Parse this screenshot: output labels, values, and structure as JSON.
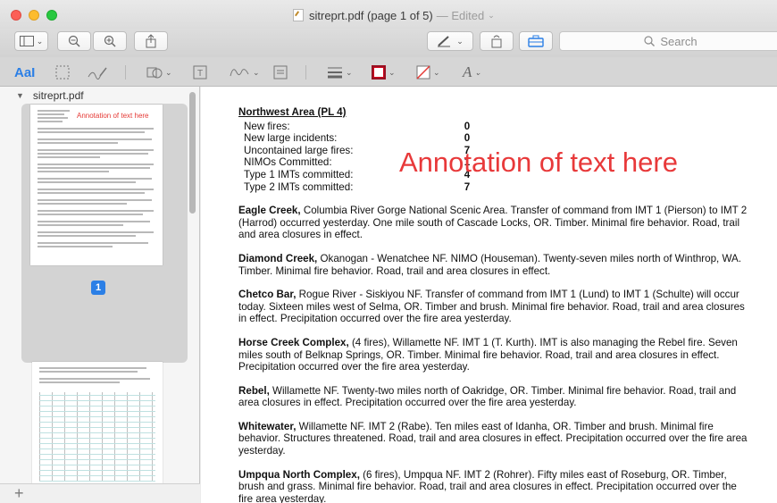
{
  "window": {
    "title": "sitreprt.pdf (page 1 of 5)",
    "edited": "— Edited"
  },
  "toolbar": {
    "search_placeholder": "Search"
  },
  "markup": {
    "text_style_label": "AaI"
  },
  "sidebar": {
    "filename": "sitreprt.pdf",
    "page_badge": "1",
    "thumb_annotation": "Annotation of text here"
  },
  "document": {
    "area_title": "Northwest Area (PL 4)",
    "stats": [
      {
        "label": "New fires:",
        "value": "0"
      },
      {
        "label": "New large incidents:",
        "value": "0"
      },
      {
        "label": "Uncontained large fires:",
        "value": "7"
      },
      {
        "label": "NIMOs Committed:",
        "value": "1"
      },
      {
        "label": "Type 1 IMTs committed:",
        "value": "4"
      },
      {
        "label": "Type 2 IMTs committed:",
        "value": "7"
      }
    ],
    "annotation": "Annotation of text here",
    "paragraphs": [
      {
        "name": "Eagle Creek,",
        "text": " Columbia River Gorge National Scenic Area. Transfer of command from IMT 1 (Pierson) to IMT 2 (Harrod) occurred yesterday. One mile south of Cascade Locks, OR. Timber. Minimal fire behavior. Road, trail and area closures in effect."
      },
      {
        "name": "Diamond Creek,",
        "text": " Okanogan - Wenatchee NF. NIMO (Houseman). Twenty-seven miles north of Winthrop, WA. Timber. Minimal fire behavior. Road, trail and area closures in effect."
      },
      {
        "name": "Chetco Bar,",
        "text": " Rogue River - Siskiyou NF. Transfer of command from IMT 1 (Lund) to IMT 1 (Schulte) will occur today. Sixteen miles west of Selma, OR. Timber and brush. Minimal fire behavior. Road, trail and area closures in effect. Precipitation occurred over the fire area yesterday."
      },
      {
        "name": "Horse Creek Complex,",
        "text": " (4 fires), Willamette NF. IMT 1 (T. Kurth). IMT is also managing the Rebel fire. Seven miles south of Belknap Springs, OR. Timber. Minimal fire behavior. Road, trail and area closures in effect. Precipitation occurred over the fire area yesterday."
      },
      {
        "name": "Rebel,",
        "text": " Willamette NF. Twenty-two miles north of Oakridge, OR. Timber. Minimal fire behavior. Road, trail and area closures in effect. Precipitation occurred over the fire area yesterday."
      },
      {
        "name": "Whitewater,",
        "text": " Willamette NF. IMT 2 (Rabe). Ten miles east of Idanha, OR. Timber and brush. Minimal fire behavior. Structures threatened. Road, trail and area closures in effect. Precipitation occurred over the fire area yesterday."
      },
      {
        "name": "Umpqua North Complex,",
        "text": " (6 fires), Umpqua NF. IMT 2 (Rohrer). Fifty miles east of Roseburg, OR. Timber, brush and grass. Minimal fire behavior. Road, trail and area closures in effect. Precipitation occurred over the fire area yesterday."
      }
    ]
  }
}
